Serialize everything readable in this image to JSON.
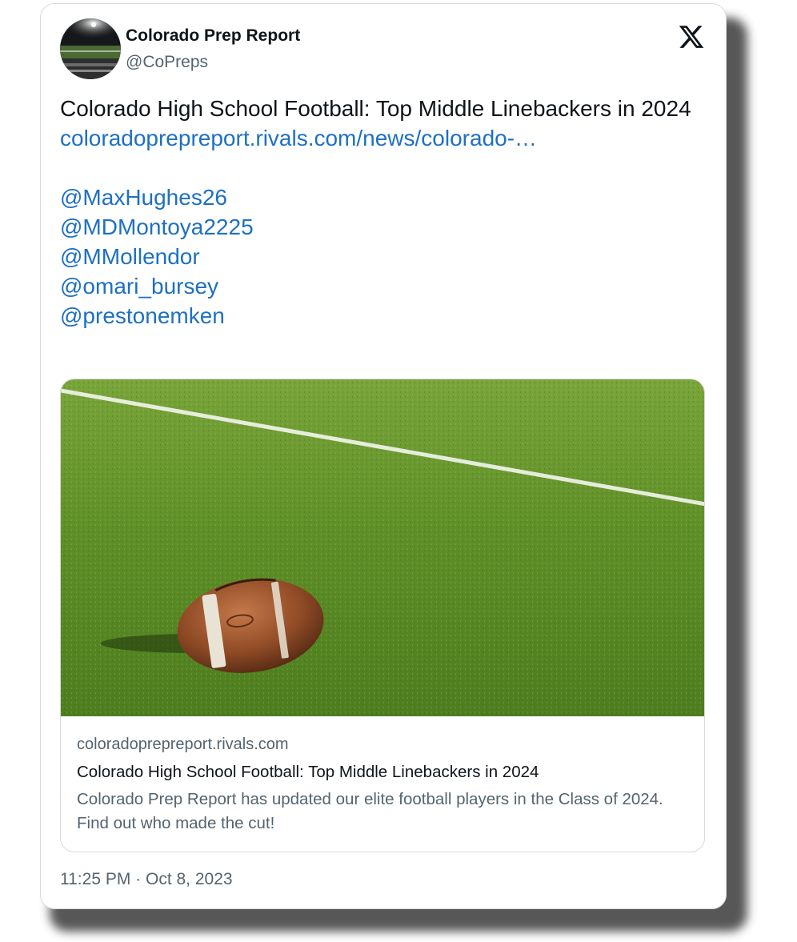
{
  "account": {
    "display_name": "Colorado Prep Report",
    "handle": "@CoPreps"
  },
  "post": {
    "text": "Colorado High School Football: Top Middle Linebackers in 2024",
    "link": "coloradoprepreport.rivals.com/news/colorado-…",
    "mentions": [
      "@MaxHughes26",
      "@MDMontoya2225",
      "@MMollendor",
      "@omari_bursey",
      "@prestonemken"
    ],
    "timestamp": "11:25 PM · Oct 8, 2023"
  },
  "link_card": {
    "domain": "coloradoprepreport.rivals.com",
    "title": "Colorado High School Football: Top Middle Linebackers in 2024",
    "description": "Colorado Prep Report has updated our elite football players in the Class of 2024. Find out who made the cut!"
  },
  "icons": {
    "logo": "x-logo-icon",
    "avatar": "stadium-night-avatar",
    "media": "football-on-turf-image"
  },
  "colors": {
    "link": "#1d70c3",
    "text": "#0f1419",
    "secondary": "#536471"
  }
}
